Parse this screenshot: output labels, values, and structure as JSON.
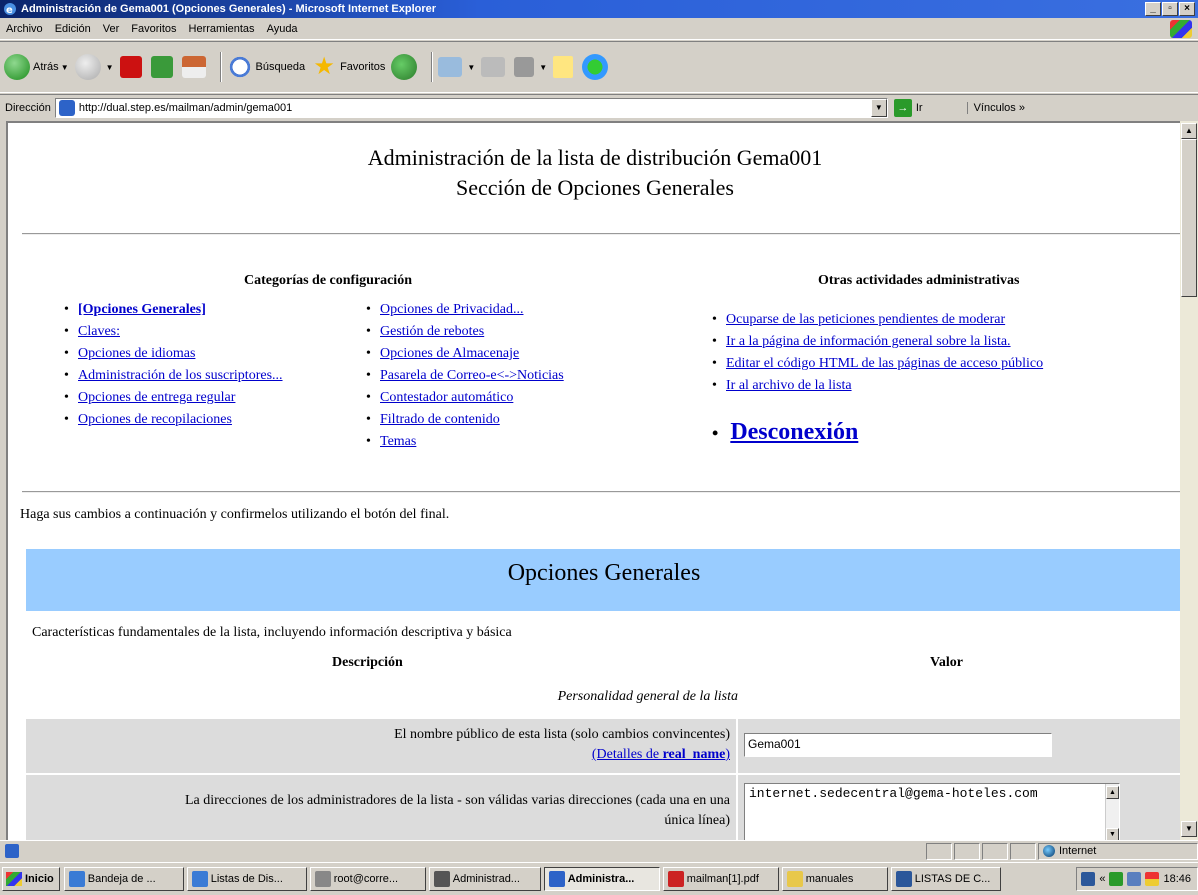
{
  "window": {
    "title": "Administración de Gema001 (Opciones Generales) - Microsoft Internet Explorer",
    "controls": [
      "_",
      "▫",
      "×"
    ]
  },
  "menu": [
    "Archivo",
    "Edición",
    "Ver",
    "Favoritos",
    "Herramientas",
    "Ayuda"
  ],
  "toolbar": {
    "back_label": "Atrás",
    "search_label": "Búsqueda",
    "favorites_label": "Favoritos"
  },
  "address": {
    "label": "Dirección",
    "url": "http://dual.step.es/mailman/admin/gema001",
    "go_label": "Ir",
    "links_label": "Vínculos"
  },
  "page": {
    "title_line1": "Administración de la lista de distribución Gema001",
    "title_line2": "Sección de Opciones Generales",
    "config_heading": "Categorías de configuración",
    "other_heading": "Otras actividades administrativas",
    "config_col1": [
      "[Opciones Generales]",
      "Claves:",
      "Opciones de idiomas",
      "Administración de los suscriptores...",
      "Opciones de entrega regular",
      "Opciones de recopilaciones"
    ],
    "config_col2": [
      "Opciones de Privacidad...",
      "Gestión de rebotes",
      "Opciones de Almacenaje",
      "Pasarela de Correo-e<->Noticias",
      "Contestador automático",
      "Filtrado de contenido",
      "Temas"
    ],
    "other_links": [
      "Ocuparse de las peticiones pendientes de moderar",
      "Ir a la página de información general sobre la lista.",
      "Editar el código HTML de las páginas de acceso público",
      "Ir al archivo de la lista"
    ],
    "logout_label": "Desconexión",
    "intro": "Haga sus cambios a continuación y confirmelos utilizando el botón del final.",
    "section_title": "Opciones Generales",
    "section_desc": "Características fundamentales de la lista, incluyendo información descriptiva y básica",
    "col_desc": "Descripción",
    "col_value": "Valor",
    "group_label": "Personalidad general de la lista",
    "rows": [
      {
        "desc": "El nombre público de esta lista (solo cambios convincentes)",
        "details_prefix": "(Detalles de ",
        "details_key": "real_name",
        "details_suffix": ")",
        "value": "Gema001"
      },
      {
        "desc_line1": "La direcciones de los administradores de la lista - son válidas varias direcciones (cada una en una",
        "desc_line2": "única línea)",
        "value": "internet.sedecentral@gema-hoteles.com"
      }
    ]
  },
  "status": {
    "zone": "Internet"
  },
  "taskbar": {
    "start_label": "Inicio",
    "tasks": [
      {
        "label": "Bandeja de ...",
        "color": "#3a7bd5"
      },
      {
        "label": "Listas de Dis...",
        "color": "#3a7bd5"
      },
      {
        "label": "root@corre...",
        "color": "#888888"
      },
      {
        "label": "Administrad...",
        "color": "#555555"
      },
      {
        "label": "Administra...",
        "color": "#2d63c8"
      },
      {
        "label": "mailman[1].pdf",
        "color": "#cc2222"
      },
      {
        "label": "manuales",
        "color": "#e8c84a"
      },
      {
        "label": "LISTAS DE C...",
        "color": "#2b579a"
      }
    ],
    "active_index": 4,
    "tray_chevron": "«",
    "time": "18:46"
  }
}
